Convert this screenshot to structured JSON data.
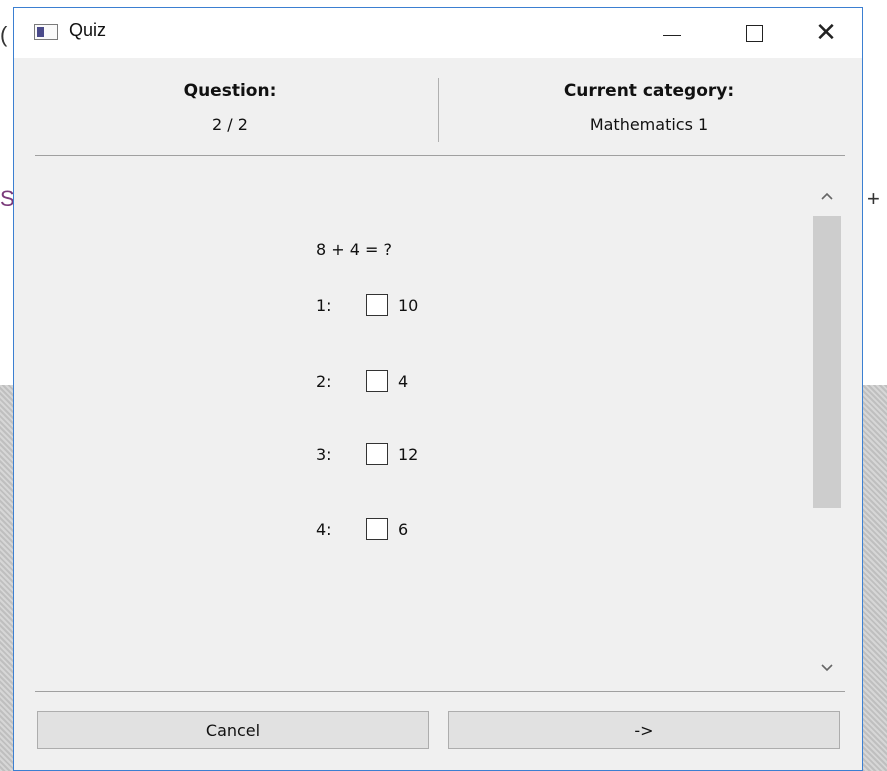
{
  "background": {
    "left_char_top": "(",
    "left_char_mid": "S",
    "right_char": "+"
  },
  "window": {
    "title": "Quiz",
    "icon": "app-window-icon",
    "minimize_label": "—",
    "maximize_icon": "maximize-icon",
    "close_label": "✕",
    "accent_color": "#3b7fd1"
  },
  "header": {
    "question_label": "Question:",
    "question_value": "2 / 2",
    "category_label": "Current category:",
    "category_value": "Mathematics 1"
  },
  "question": {
    "text": "8 + 4 = ?",
    "options": [
      {
        "number": "1:",
        "value": "10",
        "checked": false
      },
      {
        "number": "2:",
        "value": "4",
        "checked": false
      },
      {
        "number": "3:",
        "value": "12",
        "checked": false
      },
      {
        "number": "4:",
        "value": "6",
        "checked": false
      }
    ]
  },
  "scrollbar": {
    "up_icon": "chevron-up-icon",
    "down_icon": "chevron-down-icon"
  },
  "buttons": {
    "cancel_label": "Cancel",
    "next_label": "->"
  }
}
